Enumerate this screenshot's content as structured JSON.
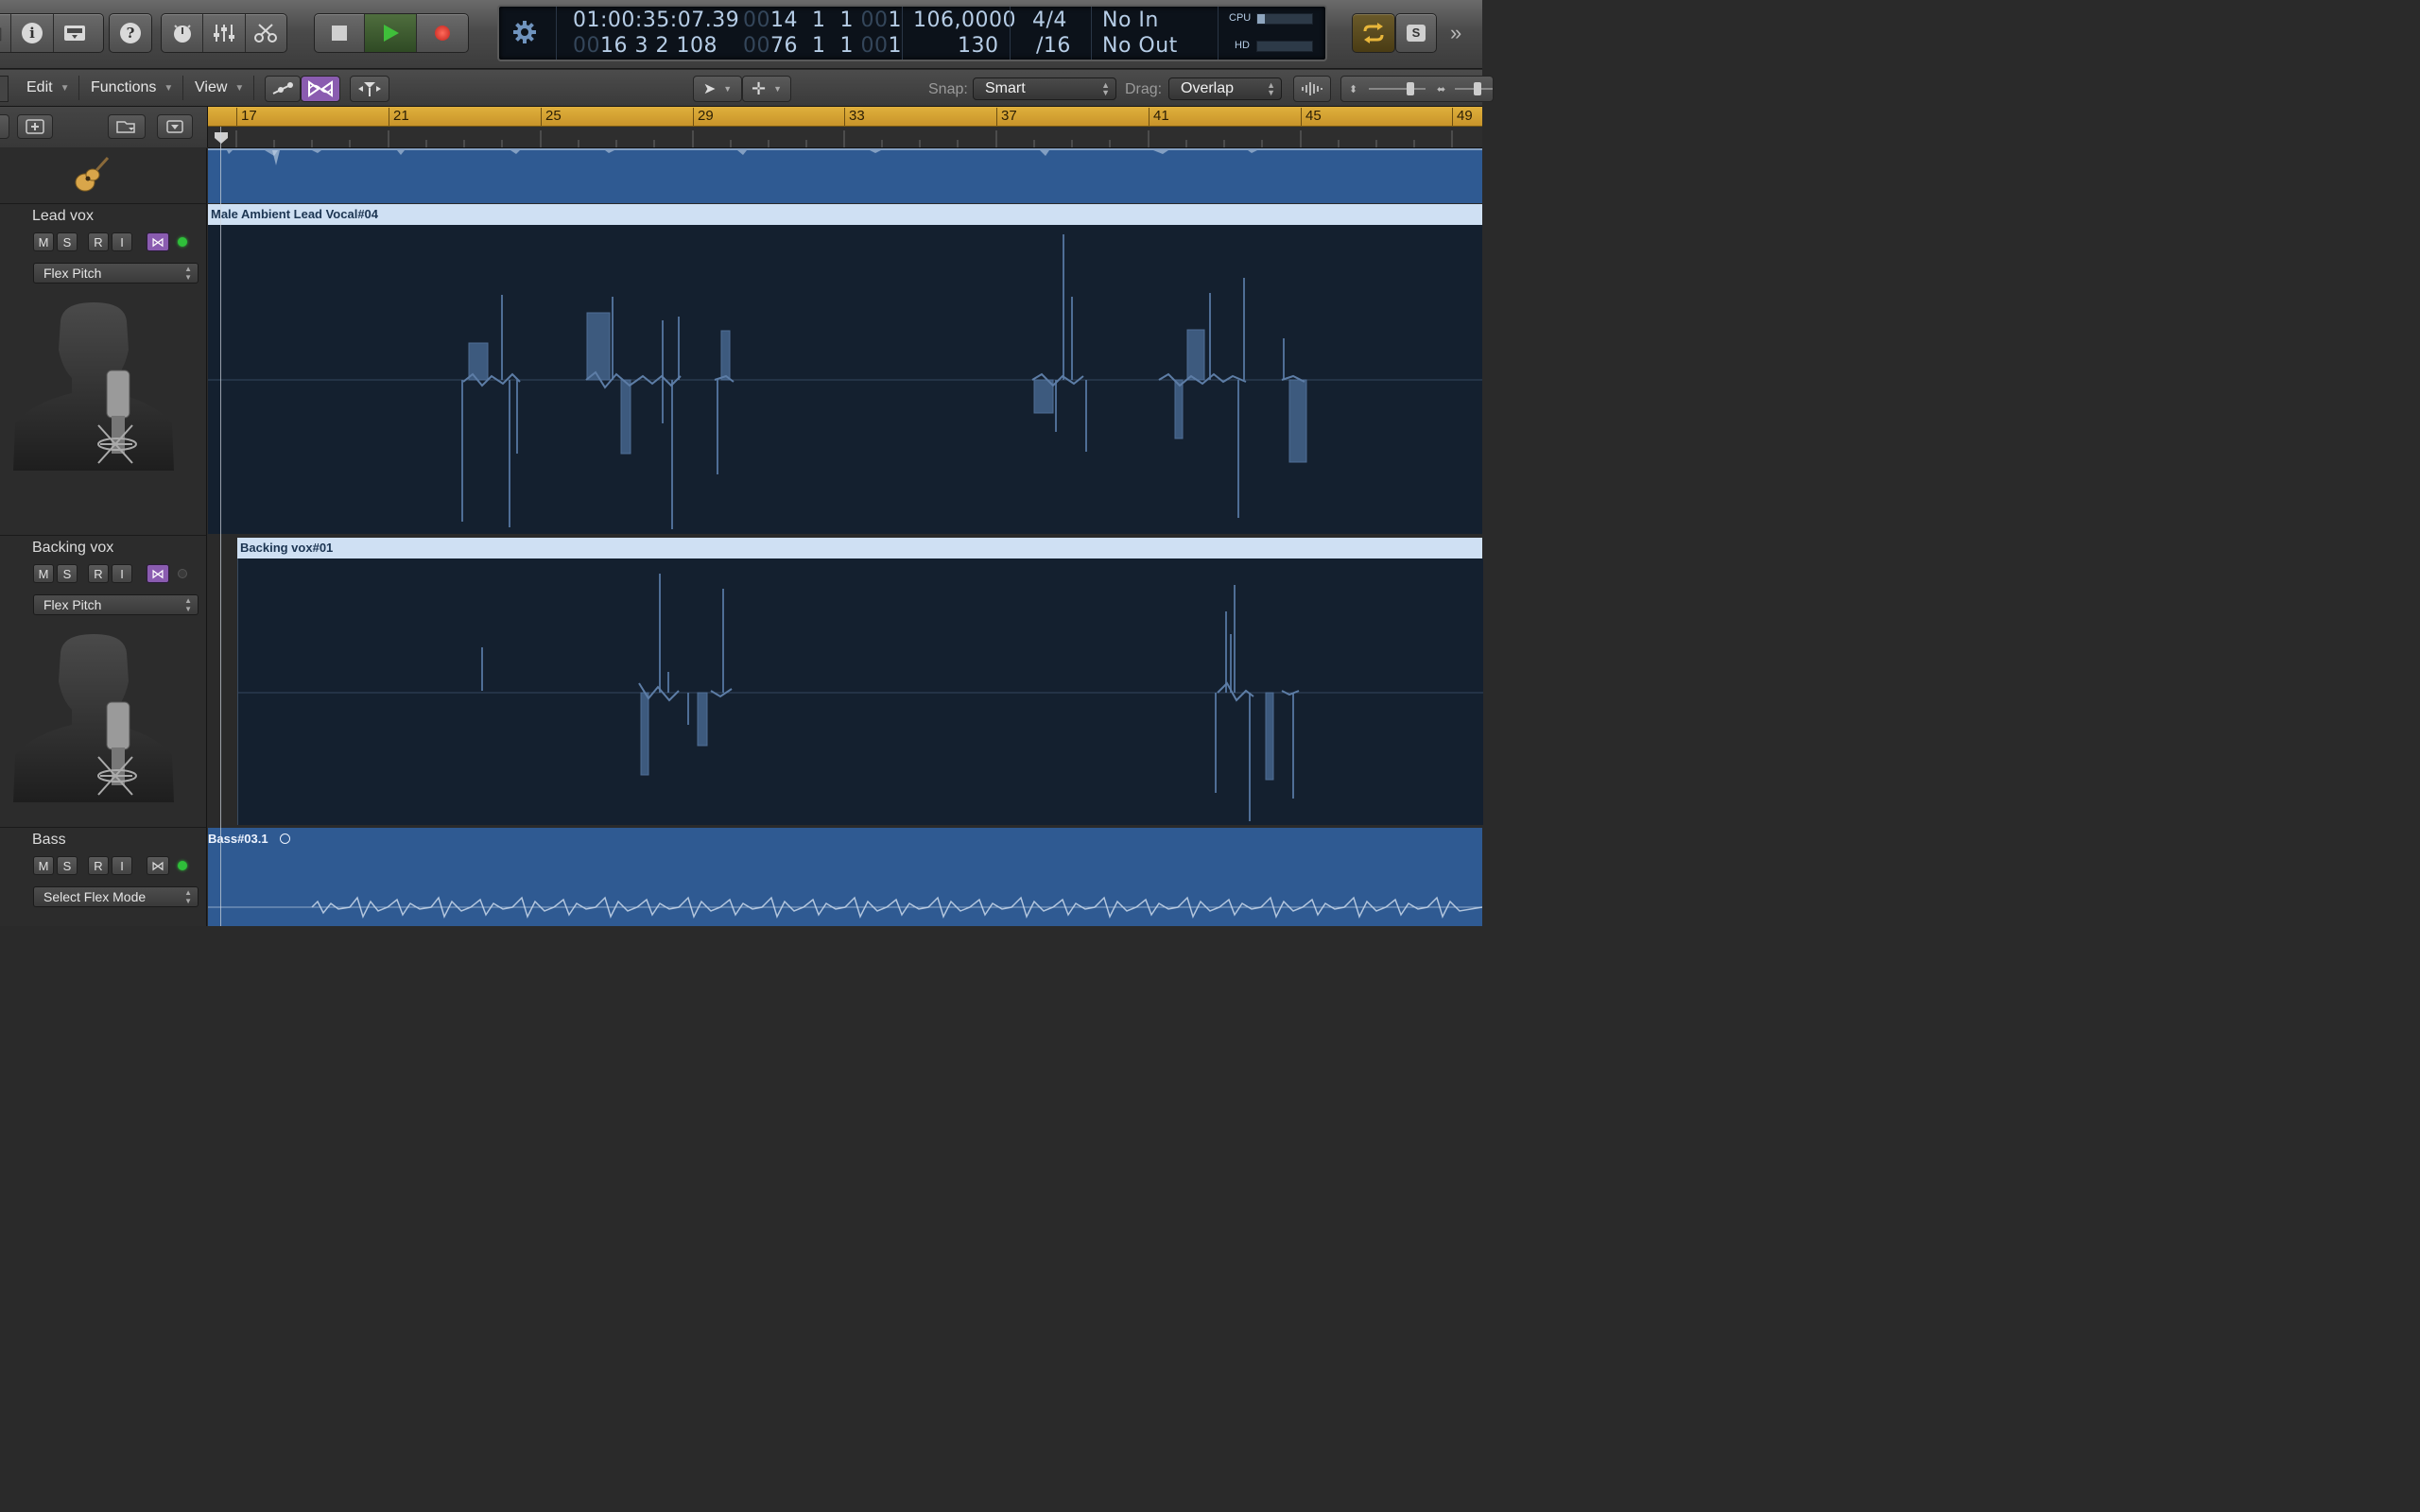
{
  "control_bar": {
    "lcd": {
      "smpte": "01:00:35:07.39",
      "bars_top_dim": "00",
      "bars_top": "14  1  1",
      "bars_top_dim2": "00",
      "bars_top_tick": "1",
      "bars_bot_dim": "00",
      "bars_bot": "16  3  2  108",
      "loc_bot_dim": "00",
      "loc_bot": "76  1  1",
      "loc_bot_dim2": "00",
      "loc_bot_tick": "1",
      "tempo": "106,0000",
      "tempo2": "130",
      "sig": "4/4",
      "division": "/16",
      "midi_in": "No In",
      "midi_out": "No Out",
      "cpu_label": "CPU",
      "hd_label": "HD"
    },
    "solo_label": "S"
  },
  "toolbar": {
    "menus": [
      "Edit",
      "Functions",
      "View"
    ],
    "snap_label": "Snap:",
    "snap_value": "Smart",
    "drag_label": "Drag:",
    "drag_value": "Overlap"
  },
  "ruler": {
    "bars": [
      "17",
      "21",
      "25",
      "29",
      "33",
      "37",
      "41",
      "45",
      "49"
    ]
  },
  "tracks": [
    {
      "name": "Lead vox",
      "mode": "Flex Pitch",
      "region": "Male Ambient Lead Vocal#04"
    },
    {
      "name": "Backing vox",
      "mode": "Flex Pitch",
      "region": "Backing vox#01"
    },
    {
      "name": "Bass",
      "mode": "Select Flex Mode",
      "region": "Bass#03.1"
    }
  ],
  "track_buttons": {
    "mute": "M",
    "solo": "S",
    "record": "R",
    "input": "I"
  },
  "colors": {
    "ruler": "#d6a534",
    "region_header": "#cfe0f3",
    "region_body": "#14202f",
    "audio_region": "#2f5a92",
    "flex_on": "#8a5cb0",
    "play_green": "#3fbf3a",
    "record_red": "#d0302a",
    "cycle_yellow": "#e8b63a"
  }
}
